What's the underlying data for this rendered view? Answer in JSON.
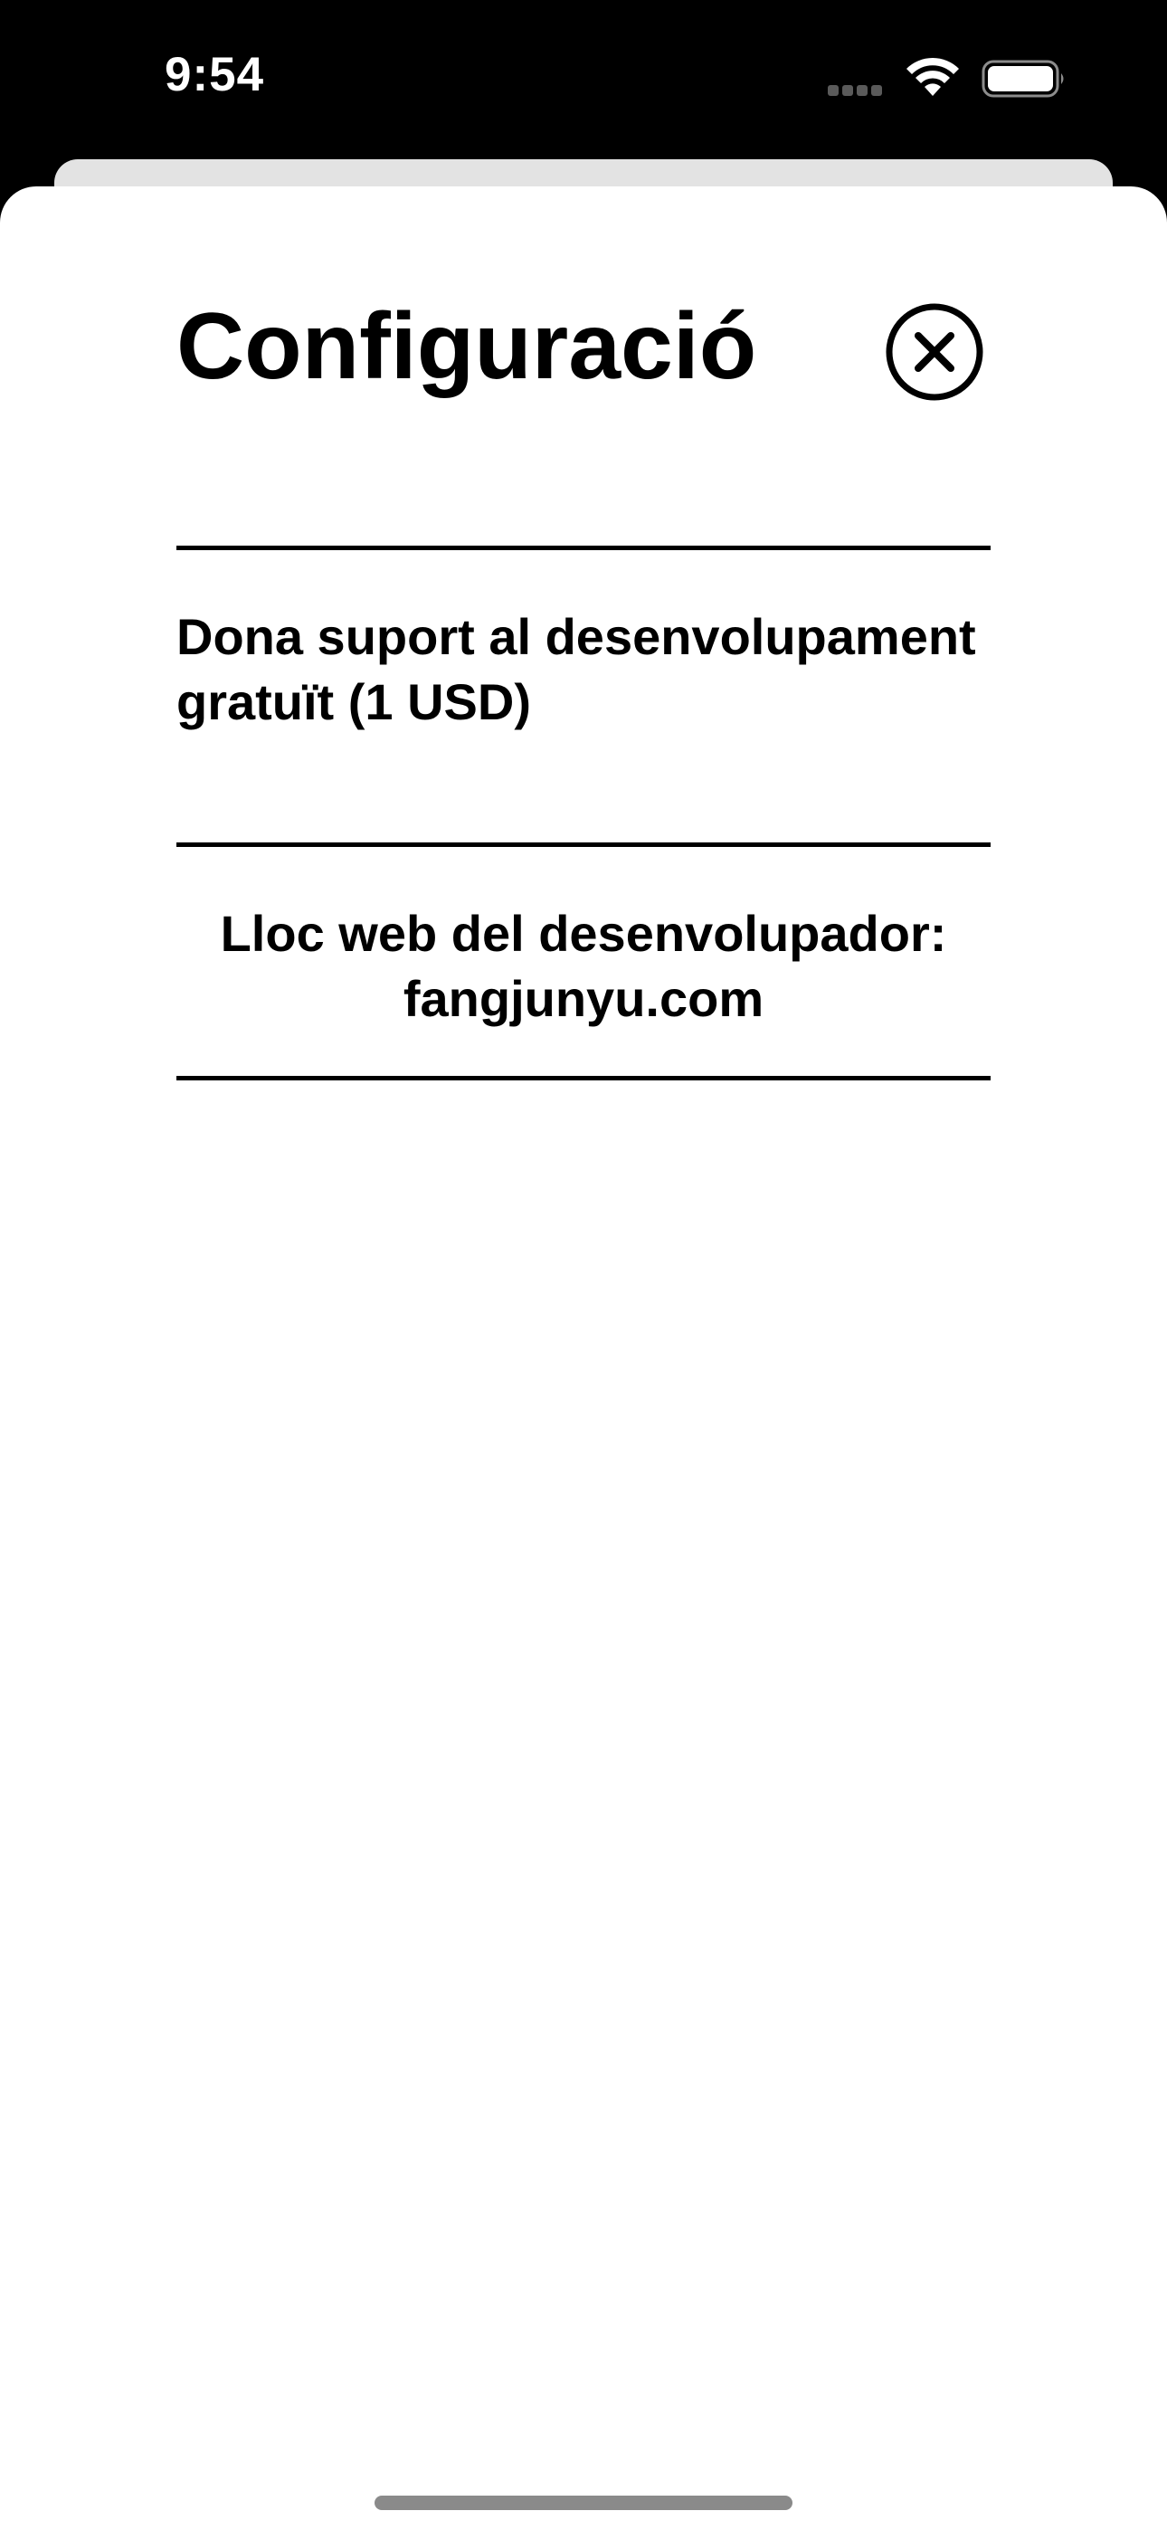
{
  "status_bar": {
    "time": "9:54",
    "icons": [
      "cellular-signal-icon",
      "wifi-icon",
      "battery-icon"
    ]
  },
  "sheet": {
    "title": "Configuració",
    "close_icon": "close-circle-icon"
  },
  "settings": {
    "support_label": "Dona suport al desenvolupament gratuït (1 USD)",
    "website_line1": "Lloc web del desenvolupador:",
    "website_line2": "fangjunyu.com"
  },
  "colors": {
    "background": "#000000",
    "sheet": "#ffffff",
    "text": "#000000",
    "back_card": "#e3e3e3"
  }
}
